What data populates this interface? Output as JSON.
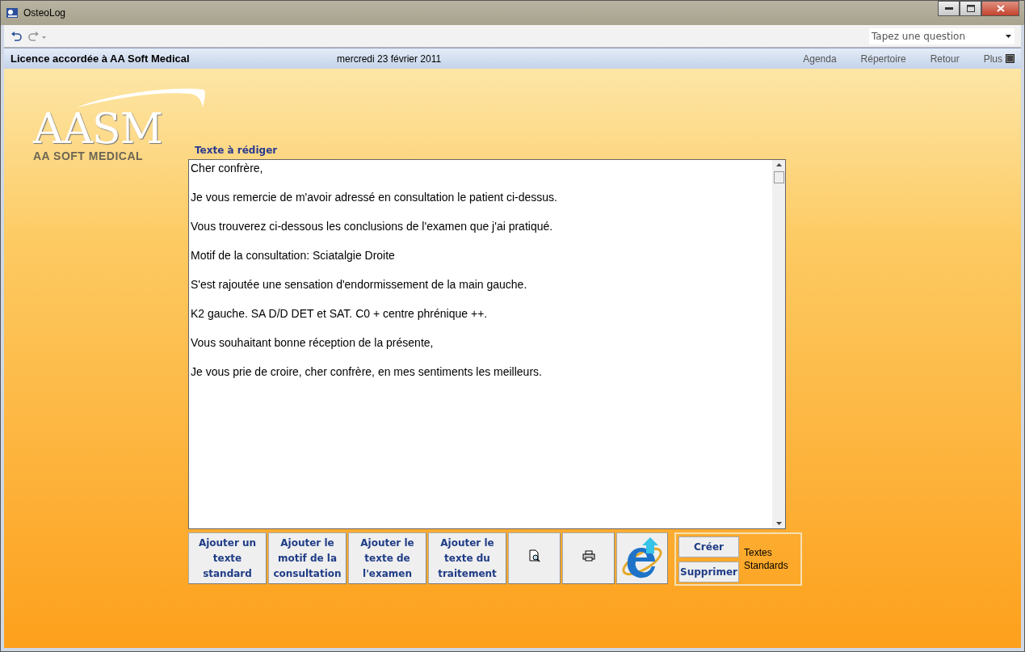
{
  "window": {
    "title": "OsteoLog"
  },
  "search": {
    "placeholder": "Tapez une question"
  },
  "header": {
    "license": "Licence accordée à  AA Soft Medical",
    "date": "mercredi 23 février 2011",
    "nav": [
      "Agenda",
      "Répertoire",
      "Retour",
      "Plus"
    ]
  },
  "logo": {
    "name": "AASM",
    "subtitle": "AA SOFT MEDICAL"
  },
  "editor": {
    "label": "Texte à rédiger",
    "paragraphs": [
      "Cher confrère,",
      "Je vous remercie de m'avoir adressé en consultation le patient ci-dessus.",
      "Vous trouverez ci-dessous les conclusions de l'examen que j'ai pratiqué.",
      "Motif de la consultation: Sciatalgie Droite",
      "S'est rajoutée une sensation d'endormissement de la main gauche.",
      "K2 gauche. SA D/D DET et SAT. C0 + centre phrénique ++.",
      "Vous souhaitant bonne réception de la présente,",
      "Je vous prie de croire, cher confrère, en mes sentiments les meilleurs."
    ]
  },
  "actions": [
    {
      "kind": "text",
      "label": "Ajouter un texte standard"
    },
    {
      "kind": "text",
      "label": "Ajouter le motif de la consultation"
    },
    {
      "kind": "text",
      "label": "Ajouter le texte de l'examen"
    },
    {
      "kind": "text",
      "label": "Ajouter le texte du traitement"
    },
    {
      "kind": "preview"
    },
    {
      "kind": "print"
    },
    {
      "kind": "web"
    }
  ],
  "standards": {
    "buttons": [
      "Créer",
      "Supprimer"
    ],
    "label": "Textes Standards"
  }
}
